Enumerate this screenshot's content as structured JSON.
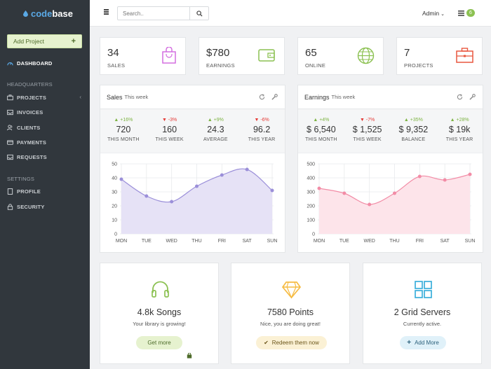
{
  "sidebar": {
    "logo_prefix": "code",
    "logo_suffix": "base",
    "add_project": "Add Project",
    "dashboard": "DASHBOARD",
    "section_headquarters": "HEADQUARTERS",
    "projects": "PROJECTS",
    "invoices": "INVOICES",
    "clients": "CLIENTS",
    "payments": "PAYMENTS",
    "requests": "REQUESTS",
    "section_settings": "SETTINGS",
    "profile": "PROFILE",
    "security": "SECURITY"
  },
  "topbar": {
    "search_placeholder": "Search..",
    "user": "Admin",
    "notifications": "6"
  },
  "stats": [
    {
      "value": "34",
      "label": "SALES",
      "color": "#d46fe0",
      "icon": "shopping-bag-icon"
    },
    {
      "value": "$780",
      "label": "EARNINGS",
      "color": "#8cc152",
      "icon": "wallet-icon"
    },
    {
      "value": "65",
      "label": "ONLINE",
      "color": "#8cc152",
      "icon": "globe-icon"
    },
    {
      "value": "7",
      "label": "PROJECTS",
      "color": "#e9573f",
      "icon": "briefcase-icon"
    }
  ],
  "sales_panel": {
    "title": "Sales",
    "subtitle": "This week",
    "metrics": [
      {
        "delta": "+16%",
        "dir": "up",
        "value": "720",
        "caption": "THIS MONTH"
      },
      {
        "delta": "-3%",
        "dir": "down",
        "value": "160",
        "caption": "THIS WEEK"
      },
      {
        "delta": "+9%",
        "dir": "up",
        "value": "24.3",
        "caption": "AVERAGE"
      },
      {
        "delta": "-6%",
        "dir": "down",
        "value": "96.2",
        "caption": "THIS YEAR"
      }
    ]
  },
  "earnings_panel": {
    "title": "Earnings",
    "subtitle": "This week",
    "metrics": [
      {
        "delta": "+4%",
        "dir": "up",
        "value": "$ 6,540",
        "caption": "THIS MONTH"
      },
      {
        "delta": "-7%",
        "dir": "down",
        "value": "$ 1,525",
        "caption": "THIS WEEK"
      },
      {
        "delta": "+35%",
        "dir": "up",
        "value": "$ 9,352",
        "caption": "BALANCE"
      },
      {
        "delta": "+28%",
        "dir": "up",
        "value": "$ 19k",
        "caption": "THIS YEAR"
      }
    ]
  },
  "chart_data": [
    {
      "type": "area",
      "categories": [
        "MON",
        "TUE",
        "WED",
        "THU",
        "FRI",
        "SAT",
        "SUN"
      ],
      "values": [
        39,
        27,
        23,
        34,
        42,
        46,
        31
      ],
      "ylim": [
        0,
        50
      ],
      "yticks": [
        "0",
        "10",
        "20",
        "30",
        "40",
        "50"
      ],
      "line_color": "#9b8fd9",
      "fill_color": "#e6e2f6",
      "grid": true
    },
    {
      "type": "area",
      "categories": [
        "MON",
        "TUE",
        "WED",
        "THU",
        "FRI",
        "SAT",
        "SUN"
      ],
      "values": [
        325,
        290,
        210,
        290,
        410,
        385,
        425
      ],
      "ylim": [
        0,
        500
      ],
      "yticks": [
        "0",
        "100",
        "200",
        "300",
        "400",
        "500"
      ],
      "line_color": "#f28ca6",
      "fill_color": "#fde4ea",
      "grid": true
    }
  ],
  "cards": [
    {
      "title": "4.8k Songs",
      "desc": "Your library is growing!",
      "action": "Get more",
      "icon": "headphones-icon",
      "color": "#8cc152",
      "bg": "#e6f2cf",
      "fg": "#4d6b2a"
    },
    {
      "title": "7580 Points",
      "desc": "Nice, you are doing great!",
      "action": "Redeem them now",
      "icon": "diamond-icon",
      "color": "#f6bb42",
      "bg": "#fbf1d5",
      "fg": "#6b5519"
    },
    {
      "title": "2 Grid Servers",
      "desc": "Currently active.",
      "action": "Add More",
      "icon": "grid-icon",
      "color": "#3bafda",
      "bg": "#e0f1f9",
      "fg": "#2a5f7a"
    }
  ]
}
